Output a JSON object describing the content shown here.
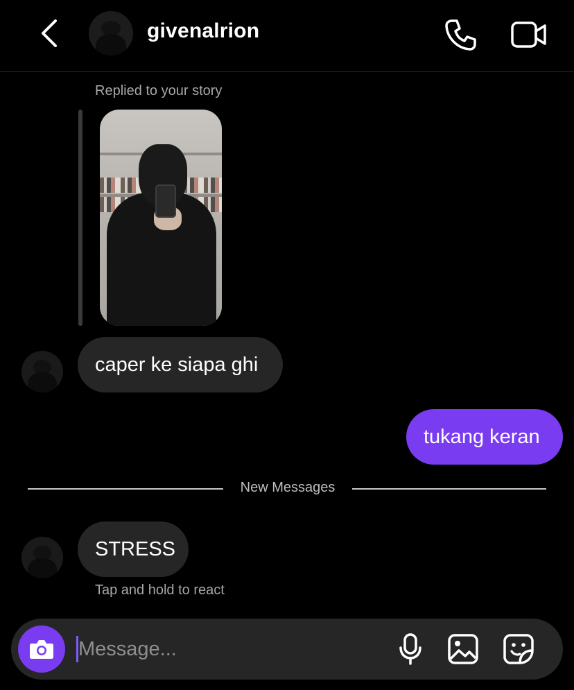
{
  "header": {
    "username": "givenalrion",
    "icons": [
      "back-icon",
      "phone-icon",
      "video-camera-icon"
    ]
  },
  "thread": {
    "story_reply_label": "Replied to your story",
    "messages": [
      {
        "from": "them",
        "text": "caper ke siapa ghi"
      },
      {
        "from": "me",
        "text": "tukang keran"
      }
    ],
    "divider_label": "New Messages",
    "new_messages": [
      {
        "from": "them",
        "text": "STRESS"
      }
    ],
    "react_hint": "Tap and hold to react"
  },
  "composer": {
    "placeholder": "Message...",
    "value": "",
    "icons": [
      "camera-icon",
      "microphone-icon",
      "gallery-icon",
      "sticker-icon"
    ]
  },
  "colors": {
    "background": "#000000",
    "incoming_bubble": "#262626",
    "outgoing_bubble": "#7a3cf0",
    "camera_button": "#7a3cf0"
  }
}
